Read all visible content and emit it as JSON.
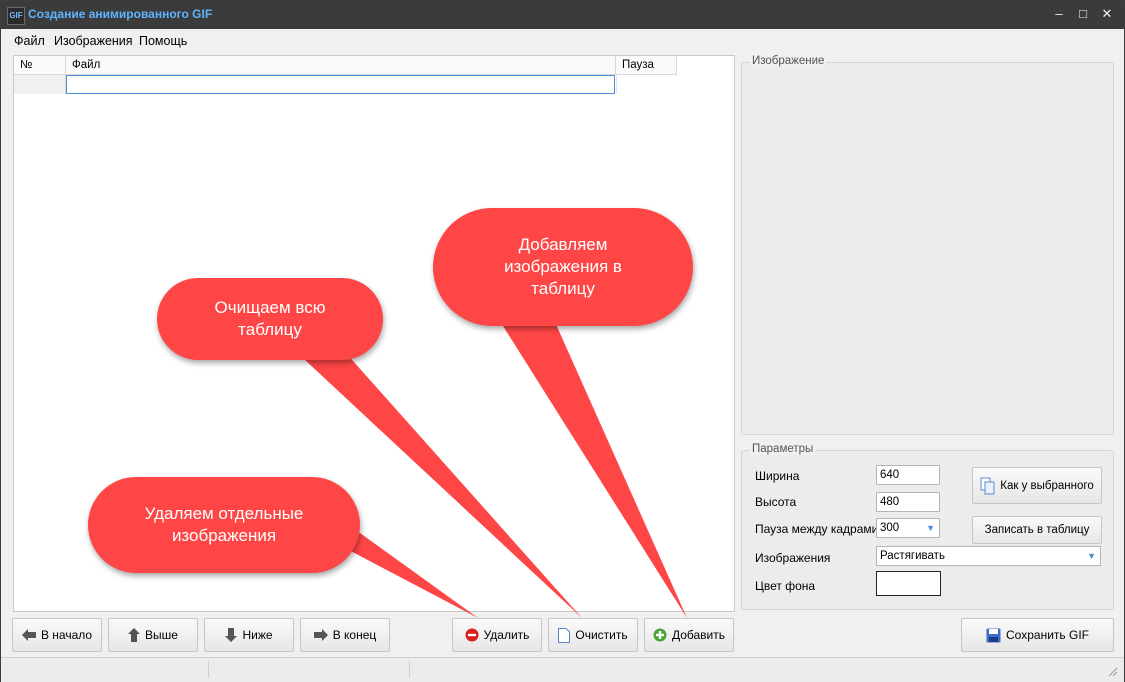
{
  "window": {
    "title": "Создание анимированного GIF",
    "icon_text": "GIF"
  },
  "titlebar": {
    "minimize": "–",
    "maximize": "□",
    "close": "✕"
  },
  "menu": {
    "items": [
      "Файл",
      "Изображения",
      "Помощь"
    ]
  },
  "table": {
    "columns": [
      "№",
      "Файл",
      "Пауза"
    ],
    "rows": [
      {
        "num": "",
        "file": "",
        "pause": ""
      }
    ]
  },
  "image_panel": {
    "legend": "Изображение"
  },
  "params": {
    "legend": "Параметры",
    "width_label": "Ширина",
    "width_value": "640",
    "height_label": "Высота",
    "height_value": "480",
    "pause_label": "Пауза между кадрами",
    "pause_value": "300",
    "images_label": "Изображения",
    "images_value": "Растягивать",
    "bgcolor_label": "Цвет фона",
    "bgcolor_value": "#ffffff",
    "as_selected_label": "Как у выбранного",
    "write_table_label": "Записать в таблицу"
  },
  "buttons": {
    "to_start": "В начало",
    "up": "Выше",
    "down": "Ниже",
    "to_end": "В конец",
    "delete": "Удалить",
    "clear": "Очистить",
    "add": "Добавить",
    "save_gif": "Сохранить GIF"
  },
  "callouts": {
    "delete_note": "Удаляем отдельные изображения",
    "clear_note": "Очищаем всю таблицу",
    "add_note": "Добавляем изображения в таблицу"
  },
  "colors": {
    "callout": "#ff4646",
    "title_text": "#5fb4ff",
    "titlebar": "#3b3b3b"
  }
}
